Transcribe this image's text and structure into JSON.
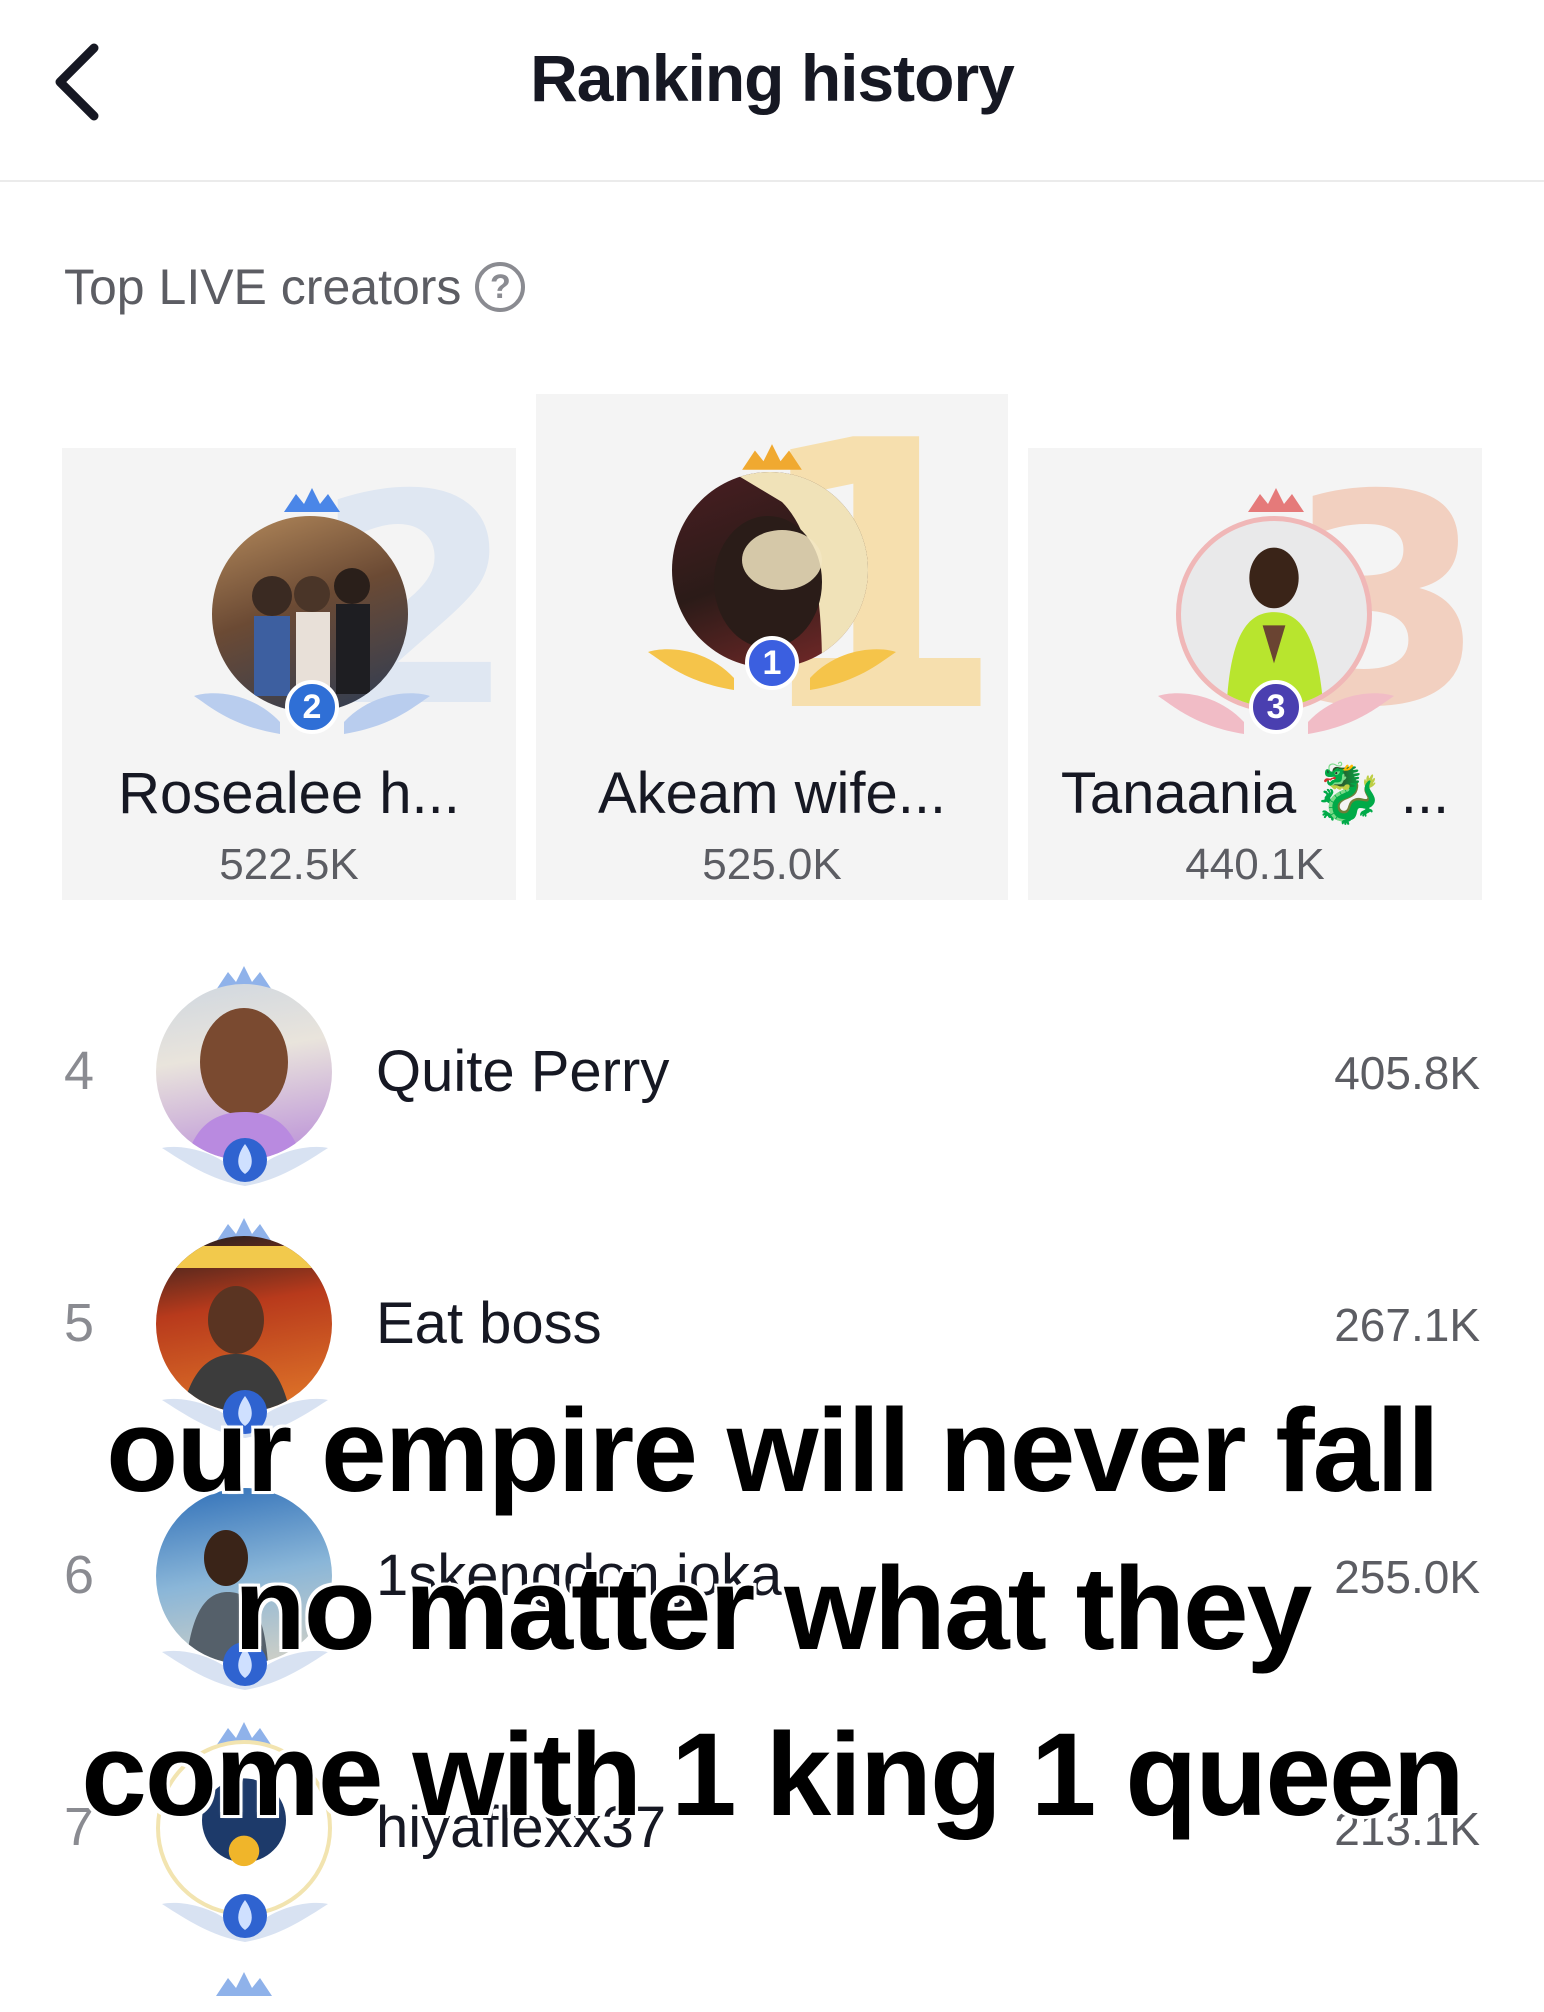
{
  "header": {
    "title": "Ranking history"
  },
  "section": {
    "label": "Top LIVE creators",
    "help_glyph": "?"
  },
  "podium": [
    {
      "rank": "2",
      "big_numeral": "2",
      "name": "Rosealee h...",
      "score": "522.5K",
      "accent": "#2f6fd6",
      "numeral_color": "#dfe7f2"
    },
    {
      "rank": "1",
      "big_numeral": "1",
      "name": "Akeam wife...",
      "score": "525.0K",
      "accent": "#e9a21a",
      "numeral_color": "#f6dfae"
    },
    {
      "rank": "3",
      "big_numeral": "3",
      "name": "Tanaania 🐉 ...",
      "score": "440.1K",
      "accent": "#4a3fb0",
      "numeral_color": "#f2d0c0"
    }
  ],
  "list": [
    {
      "rank": "4",
      "name": "Quite Perry",
      "score": "405.8K"
    },
    {
      "rank": "5",
      "name": "Eat boss",
      "score": "267.1K"
    },
    {
      "rank": "6",
      "name": "1skengdon.joka",
      "score": "255.0K"
    },
    {
      "rank": "7",
      "name": "hiyaflexx37",
      "score": "213.1K"
    }
  ],
  "overlay_caption": {
    "line1": "our empire will never fall",
    "line2": "no matter what they",
    "line3": "come with 1 king 1 queen"
  }
}
